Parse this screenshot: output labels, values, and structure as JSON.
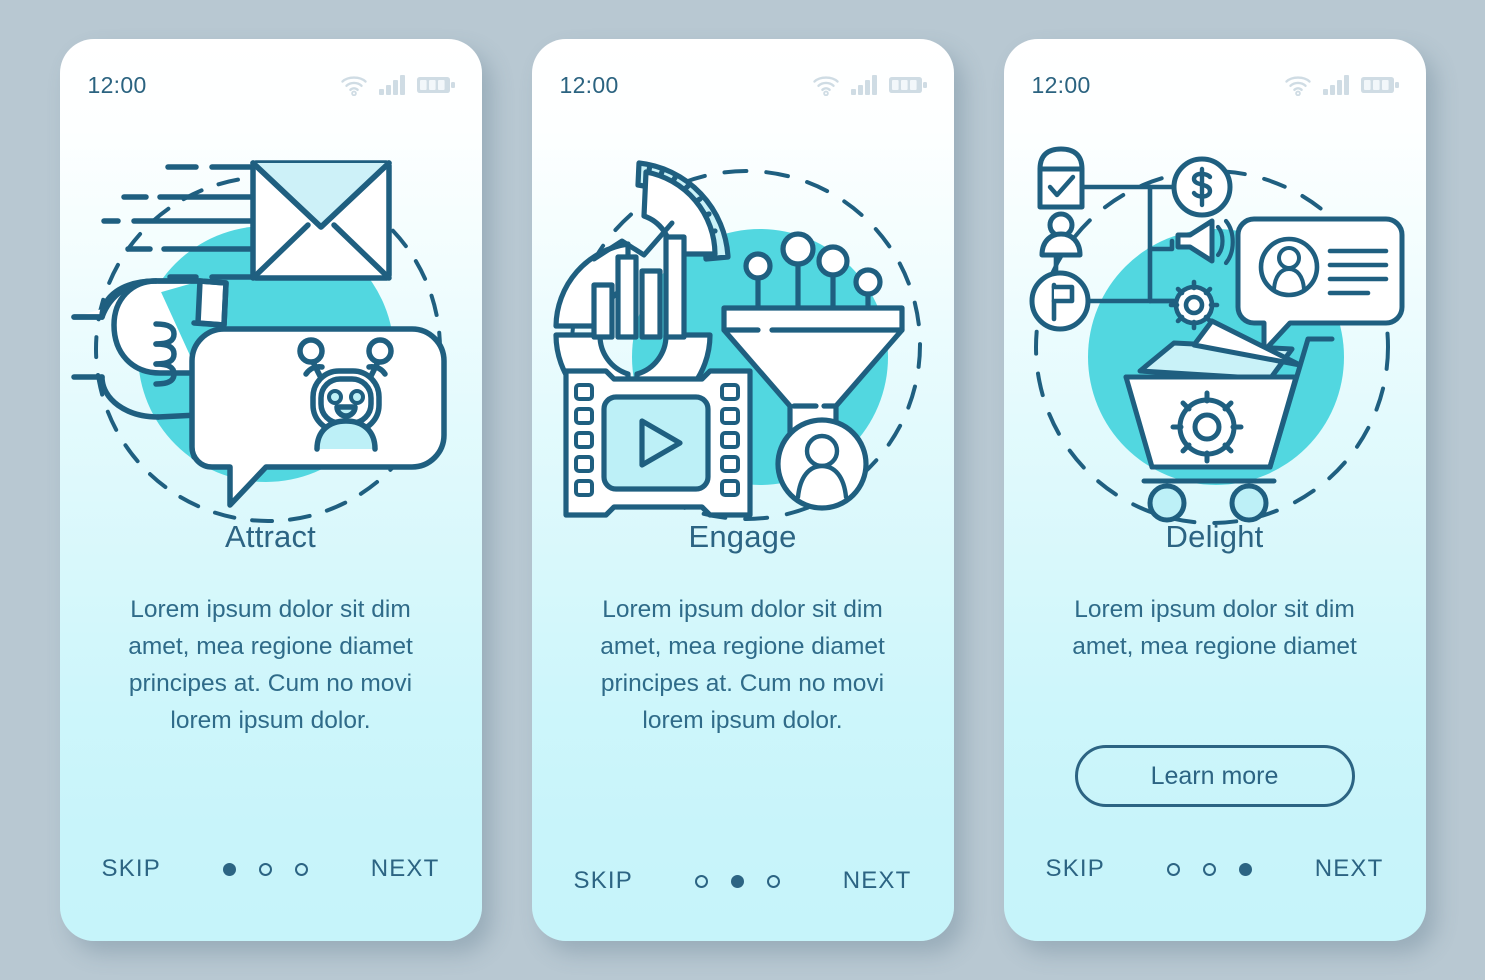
{
  "background_color": "#b8c8d2",
  "theme": {
    "stroke": "#1f5f80",
    "accent_circle": "#52d7e0",
    "fill_pale": "#c9f2f8",
    "text": "#2c6483",
    "status_icon": "#cfdce4"
  },
  "screens": [
    {
      "status": {
        "time": "12:00",
        "icons": [
          "wifi-icon",
          "signal-icon",
          "battery-icon"
        ]
      },
      "illustration": "attract-illustration",
      "illustration_elements": [
        "magnet-hand-icon",
        "envelope-icon",
        "motion-lines",
        "chatbot-speech-bubble-icon",
        "dashed-circle"
      ],
      "title": "Attract",
      "body": "Lorem ipsum dolor sit dim\namet, mea regione diamet\nprincipes at. Cum no movi\nlorem ipsum dolor.",
      "cta": null,
      "footer": {
        "skip_label": "SKIP",
        "next_label": "NEXT",
        "dots": 3,
        "active_dot": 1
      }
    },
    {
      "status": {
        "time": "12:00",
        "icons": [
          "wifi-icon",
          "signal-icon",
          "battery-icon"
        ]
      },
      "illustration": "engage-illustration",
      "illustration_elements": [
        "donut-chart-icon",
        "bar-chart-icon",
        "film-strip-play-icon",
        "funnel-icon",
        "pin-markers",
        "user-avatar-icon",
        "dashed-circle"
      ],
      "title": "Engage",
      "body": "Lorem ipsum dolor sit dim\namet, mea regione diamet\nprincipes at. Cum no movi\nlorem ipsum dolor.",
      "cta": null,
      "footer": {
        "skip_label": "SKIP",
        "next_label": "NEXT",
        "dots": 3,
        "active_dot": 2
      }
    },
    {
      "status": {
        "time": "12:00",
        "icons": [
          "wifi-icon",
          "signal-icon",
          "battery-icon"
        ]
      },
      "illustration": "delight-illustration",
      "illustration_elements": [
        "shopping-bag-check-icon",
        "user-icon",
        "flag-icon",
        "dollar-coin-icon",
        "megaphone-icon",
        "gear-icon",
        "testimonial-card-icon",
        "shopping-cart-gear-icon",
        "dashed-circle"
      ],
      "title": "Delight",
      "body": "Lorem ipsum dolor sit dim\namet, mea regione diamet",
      "cta": "Learn more",
      "footer": {
        "skip_label": "SKIP",
        "next_label": "NEXT",
        "dots": 3,
        "active_dot": 3
      }
    }
  ]
}
